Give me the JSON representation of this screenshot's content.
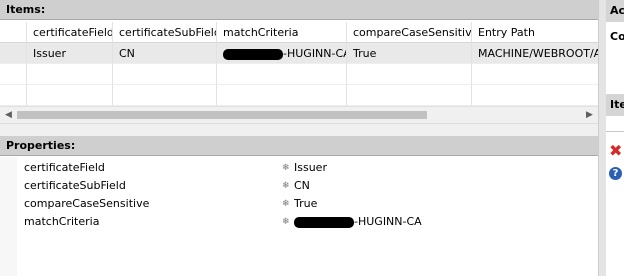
{
  "items_section": {
    "title": "Items:",
    "columns": [
      "certificateField",
      "certificateSubField",
      "matchCriteria",
      "compareCaseSensitive",
      "Entry Path"
    ],
    "rows": [
      {
        "certificateField": "Issuer",
        "certificateSubField": "CN",
        "matchCriteria_visible": "-HUGINN-CA",
        "compareCaseSensitive": "True",
        "entryPath": "MACHINE/WEBROOT/A"
      }
    ],
    "scroll_left_icon": "scroll-left-icon",
    "scroll_right_icon": "scroll-right-icon"
  },
  "properties_section": {
    "title": "Properties:",
    "rows": [
      {
        "name": "certificateField",
        "value": "Issuer"
      },
      {
        "name": "certificateSubField",
        "value": "CN"
      },
      {
        "name": "compareCaseSensitive",
        "value": "True"
      },
      {
        "name": "matchCriteria",
        "value": "-HUGINN-CA"
      }
    ],
    "value_icon": "property-edit-icon"
  },
  "right_panel": {
    "header_1": "Ac",
    "label_1": "Co",
    "header_2": "Ite",
    "remove_icon": "remove-icon",
    "help_icon": "help-icon"
  },
  "colors": {
    "header_bg": "#cfcfcf",
    "selected_row_bg": "#e9e9e9",
    "remove_icon": "#d42a2a",
    "help_icon": "#2b5fb4"
  }
}
